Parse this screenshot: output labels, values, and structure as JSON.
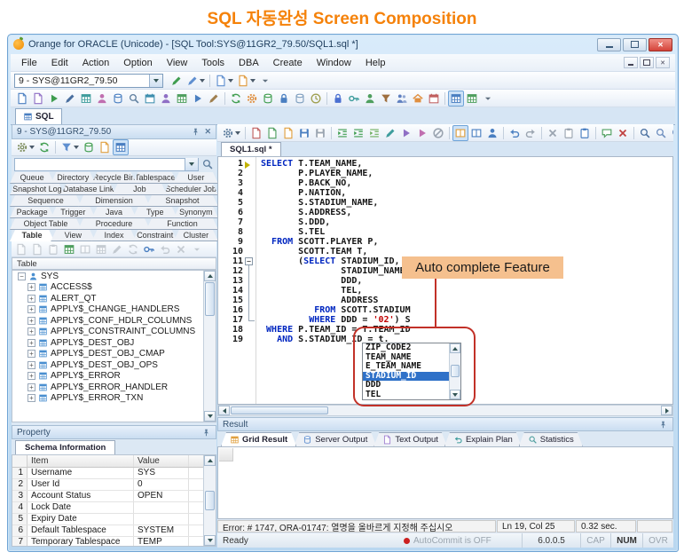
{
  "page": {
    "title": "SQL 자동완성 Screen Composition"
  },
  "window": {
    "title": "Orange for ORACLE (Unicode) - [SQL Tool:SYS@11GR2_79.50/SQL1.sql *]",
    "menu": [
      "File",
      "Edit",
      "Action",
      "Option",
      "View",
      "Tools",
      "DBA",
      "Create",
      "Window",
      "Help"
    ],
    "connection": {
      "value": "9 - SYS@11GR2_79.50"
    },
    "sql_tab": "SQL"
  },
  "toolbars": {
    "connection_icons": [
      {
        "n": "run-sql-pen-icon",
        "s": "pencil",
        "c": "#3f9d4f"
      },
      {
        "n": "run-sql-pen-alt-icon",
        "s": "pencil",
        "c": "#5f8fd0",
        "d": 1
      },
      "|",
      {
        "n": "prev-session-icon",
        "s": "doc",
        "c": "#5f8fd0",
        "d": 1
      },
      {
        "n": "next-session-icon",
        "s": "doc",
        "c": "#e09a3c",
        "d": 1
      },
      {
        "n": "toolbar-options-icon",
        "s": "caret",
        "c": "#607080"
      }
    ],
    "main_icons": [
      {
        "n": "new-sql-icon",
        "s": "doc",
        "c": "#4a7fc1"
      },
      {
        "n": "open-sql-icon",
        "s": "doc",
        "c": "#8f6fc5"
      },
      {
        "n": "run-script-icon",
        "s": "run",
        "c": "#3f9d4f"
      },
      {
        "n": "edit-schedule-icon",
        "s": "pencil",
        "c": "#4a6f9f"
      },
      {
        "n": "tablespace-icon",
        "s": "grid",
        "c": "#3f9d9d"
      },
      {
        "n": "user-admin-icon",
        "s": "person",
        "c": "#c06fb0"
      },
      {
        "n": "db-info-icon",
        "s": "db",
        "c": "#4a7fc1"
      },
      {
        "n": "search-object-icon",
        "s": "mag",
        "c": "#5f7f9f"
      },
      {
        "n": "schedule-icon",
        "s": "cal",
        "c": "#3f8faf"
      },
      {
        "n": "role-icon",
        "s": "person",
        "c": "#8f6fc5"
      },
      {
        "n": "table-editor-icon",
        "s": "grid",
        "c": "#4f9f5f"
      },
      {
        "n": "script-run-icon",
        "s": "run",
        "c": "#4a7fc1"
      },
      {
        "n": "script-edit-icon",
        "s": "pencil",
        "c": "#9f7f4f"
      },
      "|",
      {
        "n": "refresh-icon",
        "s": "refresh",
        "c": "#3f9d4f"
      },
      {
        "n": "jobs-icon",
        "s": "gear",
        "c": "#e08f3f"
      },
      {
        "n": "export-icon",
        "s": "db",
        "c": "#3f9d4f"
      },
      {
        "n": "db-lock-icon",
        "s": "lock",
        "c": "#4a7fc1"
      },
      {
        "n": "db-monitor-icon",
        "s": "db",
        "c": "#7f9fbf"
      },
      {
        "n": "history-icon",
        "s": "clock",
        "c": "#9f9f4f"
      },
      "|",
      {
        "n": "session-lock-icon",
        "s": "lock",
        "c": "#4a6fd1"
      },
      {
        "n": "privilege-key-icon",
        "s": "key",
        "c": "#3f9d9d"
      },
      {
        "n": "grant-user-icon",
        "s": "person",
        "c": "#4f9f5f"
      },
      {
        "n": "audit-icon",
        "s": "funnel",
        "c": "#9f6f3f"
      },
      {
        "n": "sessions-icon",
        "s": "people",
        "c": "#5f7fbf"
      },
      {
        "n": "home-icon",
        "s": "home",
        "c": "#e08f3f"
      },
      {
        "n": "calendar-icon",
        "s": "cal",
        "c": "#c05f5f"
      },
      "|",
      {
        "n": "grid-view-icon",
        "s": "grid",
        "c": "#4a7fc1",
        "p": 1
      },
      {
        "n": "grid-alt-icon",
        "s": "grid",
        "c": "#4f9f5f"
      },
      {
        "n": "toolbar-more-icon",
        "s": "caret",
        "c": "#607080"
      }
    ],
    "editor_icons": [
      {
        "n": "editor-settings-icon",
        "s": "gear",
        "c": "#5f7f9f",
        "d": 1
      },
      "|",
      {
        "n": "close-file-icon",
        "s": "doc",
        "c": "#c05f5f"
      },
      {
        "n": "new-file-icon",
        "s": "doc",
        "c": "#4f9f5f"
      },
      {
        "n": "open-file-icon",
        "s": "doc",
        "c": "#e0a040"
      },
      {
        "n": "save-icon",
        "s": "floppy",
        "c": "#4a7fc1"
      },
      {
        "n": "save-all-icon",
        "s": "floppy",
        "c": "#9aa4b0"
      },
      "|",
      {
        "n": "indent-icon",
        "s": "indent",
        "c": "#3f9d4f"
      },
      {
        "n": "outdent-icon",
        "s": "indent",
        "c": "#3f9d4f"
      },
      {
        "n": "format-lines-icon",
        "s": "indent",
        "c": "#6faf5f"
      },
      {
        "n": "format-sql-icon",
        "s": "pencil",
        "c": "#3f9d9d"
      },
      {
        "n": "check-syntax-icon",
        "s": "run",
        "c": "#8f6fc5"
      },
      {
        "n": "compile-icon",
        "s": "run",
        "c": "#c06fb0"
      },
      {
        "n": "cancel-query-icon",
        "s": "stopc",
        "c": "#9aa4b0"
      },
      "|",
      {
        "n": "describe-icon",
        "s": "book",
        "c": "#e0a040",
        "p": 1
      },
      {
        "n": "output-icon",
        "s": "book",
        "c": "#4a7fc1"
      },
      {
        "n": "session-info-icon",
        "s": "person",
        "c": "#4a7fc1"
      },
      "|",
      {
        "n": "undo-icon",
        "s": "undo",
        "c": "#4a7fc1"
      },
      {
        "n": "redo-icon",
        "s": "undo",
        "c": "#9aa4b0",
        "f": 1
      },
      "|",
      {
        "n": "cut-icon",
        "s": "xmark",
        "c": "#9aa4b0"
      },
      {
        "n": "copy-icon",
        "s": "clip",
        "c": "#9aa4b0"
      },
      {
        "n": "paste-icon",
        "s": "clip",
        "c": "#4a7fc1"
      },
      "|",
      {
        "n": "comment-icon",
        "s": "chat",
        "c": "#4f9f5f"
      },
      {
        "n": "clear-icon",
        "s": "xmark",
        "c": "#c04040"
      },
      "|",
      {
        "n": "find-icon",
        "s": "mag",
        "c": "#4a6f9f"
      },
      {
        "n": "find-next-icon",
        "s": "mag",
        "c": "#6f8fbf"
      },
      {
        "n": "find-prev-icon",
        "s": "mag",
        "c": "#6f8fbf"
      },
      {
        "n": "replace-icon",
        "s": "mag",
        "c": "#3f9d9d"
      }
    ],
    "browser_icons": [
      {
        "n": "browser-settings-icon",
        "s": "gear",
        "c": "#7f8f5f",
        "d": 1
      },
      {
        "n": "browser-refresh-icon",
        "s": "refresh",
        "c": "#3f9d4f"
      },
      "|",
      {
        "n": "filter-icon",
        "s": "funnel",
        "c": "#5f8fd0",
        "d": 1
      },
      {
        "n": "export-ddl-icon",
        "s": "db",
        "c": "#3f9d4f"
      },
      {
        "n": "open-browser-icon",
        "s": "doc",
        "c": "#e0a040"
      },
      {
        "n": "detail-view-icon",
        "s": "grid",
        "c": "#4a7fc1",
        "p": 1
      }
    ],
    "object_icons": [
      {
        "n": "obj-new-icon",
        "s": "doc",
        "x": 1
      },
      {
        "n": "obj-open-icon",
        "s": "doc",
        "x": 1
      },
      {
        "n": "obj-copy-icon",
        "s": "clip",
        "x": 1
      },
      {
        "n": "obj-add-table-icon",
        "s": "grid",
        "c": "#4f9f5f"
      },
      {
        "n": "obj-describe-icon",
        "s": "book",
        "x": 1
      },
      {
        "n": "obj-data-icon",
        "s": "grid",
        "x": 1
      },
      {
        "n": "obj-script-icon",
        "s": "pencil",
        "x": 1
      },
      {
        "n": "obj-sync-icon",
        "s": "refresh",
        "x": 1
      },
      {
        "n": "obj-grant-icon",
        "s": "key",
        "c": "#4a7fc1"
      },
      {
        "n": "obj-export-icon",
        "s": "undo",
        "x": 1
      },
      {
        "n": "obj-drop-icon",
        "s": "xmark",
        "x": 1
      },
      {
        "n": "obj-more-icon",
        "s": "caret",
        "x": 1
      }
    ]
  },
  "browser": {
    "header": "9 - SYS@11GR2_79.50",
    "tab_rows": [
      [
        "Queue",
        "Directory",
        "Recycle Bin",
        "Tablespace",
        "User"
      ],
      [
        "Snapshot Log",
        "Database Link",
        "Job",
        "Scheduler Job"
      ],
      [
        "Sequence",
        "Dimension",
        "Snapshot"
      ],
      [
        "Package",
        "Trigger",
        "Java",
        "Type",
        "Synonym"
      ],
      [
        "Object Table",
        "Procedure",
        "Function"
      ],
      [
        "Table",
        "View",
        "Index",
        "Constraint",
        "Cluster"
      ]
    ],
    "active_tab": "Table",
    "list_title": "Table",
    "schema": "SYS",
    "tables": [
      "ACCESS$",
      "ALERT_QT",
      "APPLY$_CHANGE_HANDLERS",
      "APPLY$_CONF_HDLR_COLUMNS",
      "APPLY$_CONSTRAINT_COLUMNS",
      "APPLY$_DEST_OBJ",
      "APPLY$_DEST_OBJ_CMAP",
      "APPLY$_DEST_OBJ_OPS",
      "APPLY$_ERROR",
      "APPLY$_ERROR_HANDLER",
      "APPLY$_ERROR_TXN"
    ]
  },
  "property": {
    "header": "Property",
    "tab": "Schema Information",
    "columns": [
      "Item",
      "Value"
    ],
    "rows": [
      [
        "1",
        "Username",
        "SYS"
      ],
      [
        "2",
        "User Id",
        "0"
      ],
      [
        "3",
        "Account Status",
        "OPEN"
      ],
      [
        "4",
        "Lock Date",
        ""
      ],
      [
        "5",
        "Expiry Date",
        ""
      ],
      [
        "6",
        "Default Tablespace",
        "SYSTEM"
      ],
      [
        "7",
        "Temporary Tablespace",
        "TEMP"
      ]
    ]
  },
  "editor": {
    "tab": "SQL1.sql *",
    "syntax": {
      "keywords": [
        "SELECT",
        "FROM",
        "WHERE",
        "AND"
      ],
      "keyword_color": "#0026c0",
      "string_color": "#c00000",
      "text_color": "#151515"
    },
    "lines": [
      "SELECT T.TEAM_NAME,",
      "       P.PLAYER_NAME,",
      "       P.BACK_NO,",
      "       P.NATION,",
      "       S.STADIUM_NAME,",
      "       S.ADDRESS,",
      "       S.DDD,",
      "       S.TEL",
      "  FROM SCOTT.PLAYER P,",
      "       SCOTT.TEAM T,",
      "       (SELECT STADIUM_ID,",
      "               STADIUM_NAME,",
      "               DDD,",
      "               TEL,",
      "               ADDRESS",
      "          FROM SCOTT.STADIUM",
      "         WHERE DDD = '02') S",
      " WHERE P.TEAM_ID = T.TEAM_ID",
      "   AND S.STADIUM_ID = t."
    ]
  },
  "autocomplete": {
    "items": [
      "ZIP_CODE2",
      "TEAM_NAME",
      "E_TEAM_NAME",
      "STADIUM_ID",
      "DDD",
      "TEL"
    ],
    "selected": "STADIUM_ID",
    "selected_index": 3
  },
  "annotation": {
    "label": "Auto complete Feature",
    "bg": "#f5c08e",
    "line_color": "#c23128"
  },
  "result": {
    "header": "Result",
    "active_tab": "Grid Result",
    "tabs": [
      {
        "label": "Grid Result",
        "s": "grid",
        "c": "#e0a040"
      },
      {
        "label": "Server Output",
        "s": "db",
        "c": "#5f8fd0"
      },
      {
        "label": "Text Output",
        "s": "doc",
        "c": "#9f7fd0"
      },
      {
        "label": "Explain Plan",
        "s": "undo",
        "c": "#3f9d9d"
      },
      {
        "label": "Statistics",
        "s": "mag",
        "c": "#4f9f9f"
      }
    ]
  },
  "statusbar": {
    "error": "Error: # 1747, ORA-01747: 열명을 올바르게 지정해 주십시오",
    "position": "Ln 19, Col 25",
    "elapsed": "0.32 sec.",
    "ready": "Ready",
    "autocommit": "AutoCommit is OFF",
    "version": "6.0.0.5",
    "cap": "CAP",
    "num": "NUM",
    "ovr": "OVR"
  }
}
